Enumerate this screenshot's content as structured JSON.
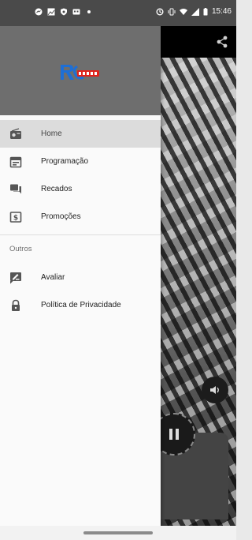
{
  "status_bar": {
    "time": "15:46",
    "left_icons": [
      "messenger-icon",
      "gallery-icon",
      "shield-icon",
      "wallet-icon",
      "dot-icon"
    ],
    "right_icons": [
      "sync-icon",
      "vibrate-icon",
      "wifi-icon",
      "signal-icon",
      "battery-icon"
    ]
  },
  "drawer": {
    "logo_alt": "Rádio",
    "items": [
      {
        "label": "Home",
        "icon": "radio-icon",
        "active": true
      },
      {
        "label": "Programação",
        "icon": "calendar-icon",
        "active": false
      },
      {
        "label": "Recados",
        "icon": "chat-icon",
        "active": false
      },
      {
        "label": "Promoções",
        "icon": "dollar-icon",
        "active": false
      }
    ],
    "section_title": "Outros",
    "other_items": [
      {
        "label": "Avaliar",
        "icon": "rate-review-icon"
      },
      {
        "label": "Política de Privacidade",
        "icon": "lock-icon"
      }
    ]
  },
  "colors": {
    "header_bg": "#6e6e6e",
    "drawer_bg": "#fafafa",
    "active_item_bg": "#dcdcdc",
    "icon_gray": "#555555",
    "logo_blue": "#1e6fd6",
    "logo_red": "#e0221b"
  }
}
